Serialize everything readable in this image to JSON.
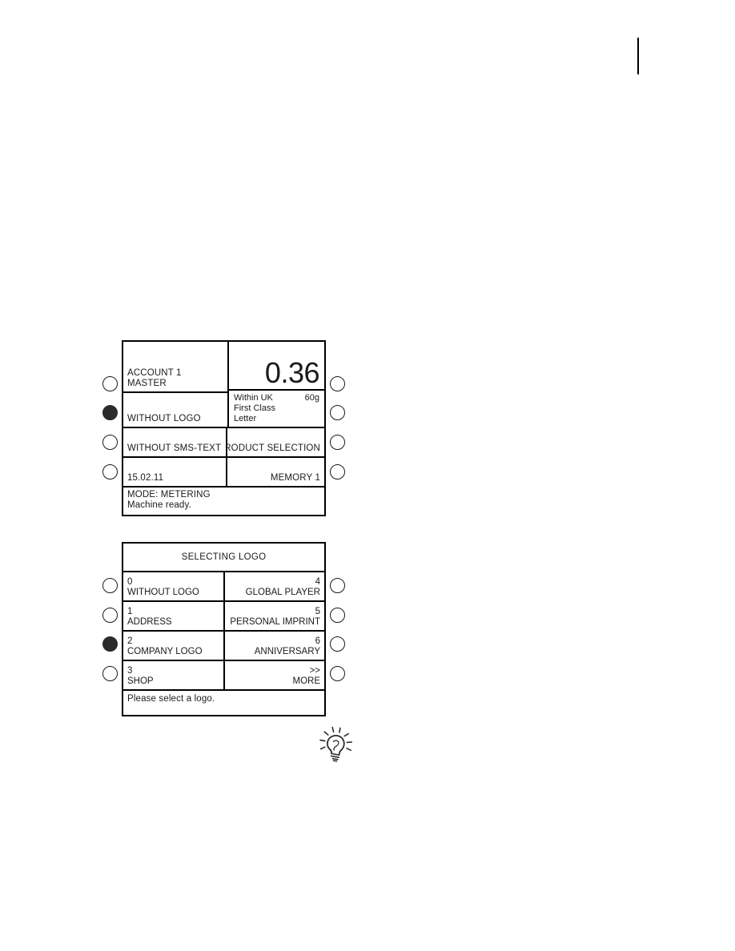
{
  "page": {
    "background_color": "#ffffff",
    "ink_color": "#1a1a1a",
    "corner_rule_label": "page-corner-rule"
  },
  "metering_display": {
    "name": "metering-mode-display",
    "left_column": {
      "account_label": "ACCOUNT 1",
      "account_name": "MASTER",
      "logo_setting": "WITHOUT LOGO",
      "sms_setting": "WITHOUT SMS-TEXT",
      "date": "15.02.11"
    },
    "right_column": {
      "amount": "0.36",
      "product_lines": [
        "Within UK",
        "First Class",
        "Letter"
      ],
      "weight": "60g",
      "product_selection_label": "PRODUCT SELECTION",
      "memory_label": "MEMORY 1"
    },
    "status": {
      "mode_line": "MODE: METERING",
      "state_line": "Machine ready."
    },
    "left_buttons": [
      {
        "name": "account-button",
        "selected": false
      },
      {
        "name": "logo-button",
        "selected": true
      },
      {
        "name": "sms-text-button",
        "selected": false
      },
      {
        "name": "date-button",
        "selected": false
      }
    ],
    "right_buttons": [
      {
        "name": "amount-button",
        "selected": false
      },
      {
        "name": "product-info-button",
        "selected": false
      },
      {
        "name": "product-selection-button",
        "selected": false
      },
      {
        "name": "memory-button",
        "selected": false
      }
    ]
  },
  "logo_display": {
    "name": "selecting-logo-display",
    "title": "SELECTING LOGO",
    "options_left": [
      {
        "index": "0",
        "label": "WITHOUT LOGO"
      },
      {
        "index": "1",
        "label": "ADDRESS"
      },
      {
        "index": "2",
        "label": "COMPANY LOGO"
      },
      {
        "index": "3",
        "label": "SHOP"
      }
    ],
    "options_right": [
      {
        "index": "4",
        "label": "GLOBAL PLAYER"
      },
      {
        "index": "5",
        "label": "PERSONAL IMPRINT"
      },
      {
        "index": "6",
        "label": "ANNIVERSARY"
      },
      {
        "index": ">>",
        "label": "MORE"
      }
    ],
    "message": "Please select a logo.",
    "left_buttons": [
      {
        "name": "logo-option-0-button",
        "selected": false
      },
      {
        "name": "logo-option-1-button",
        "selected": false
      },
      {
        "name": "logo-option-2-button",
        "selected": true
      },
      {
        "name": "logo-option-3-button",
        "selected": false
      }
    ],
    "right_buttons": [
      {
        "name": "logo-option-4-button",
        "selected": false
      },
      {
        "name": "logo-option-5-button",
        "selected": false
      },
      {
        "name": "logo-option-6-button",
        "selected": false
      },
      {
        "name": "logo-more-button",
        "selected": false
      }
    ]
  },
  "hint": {
    "icon": "lightbulb-icon"
  }
}
